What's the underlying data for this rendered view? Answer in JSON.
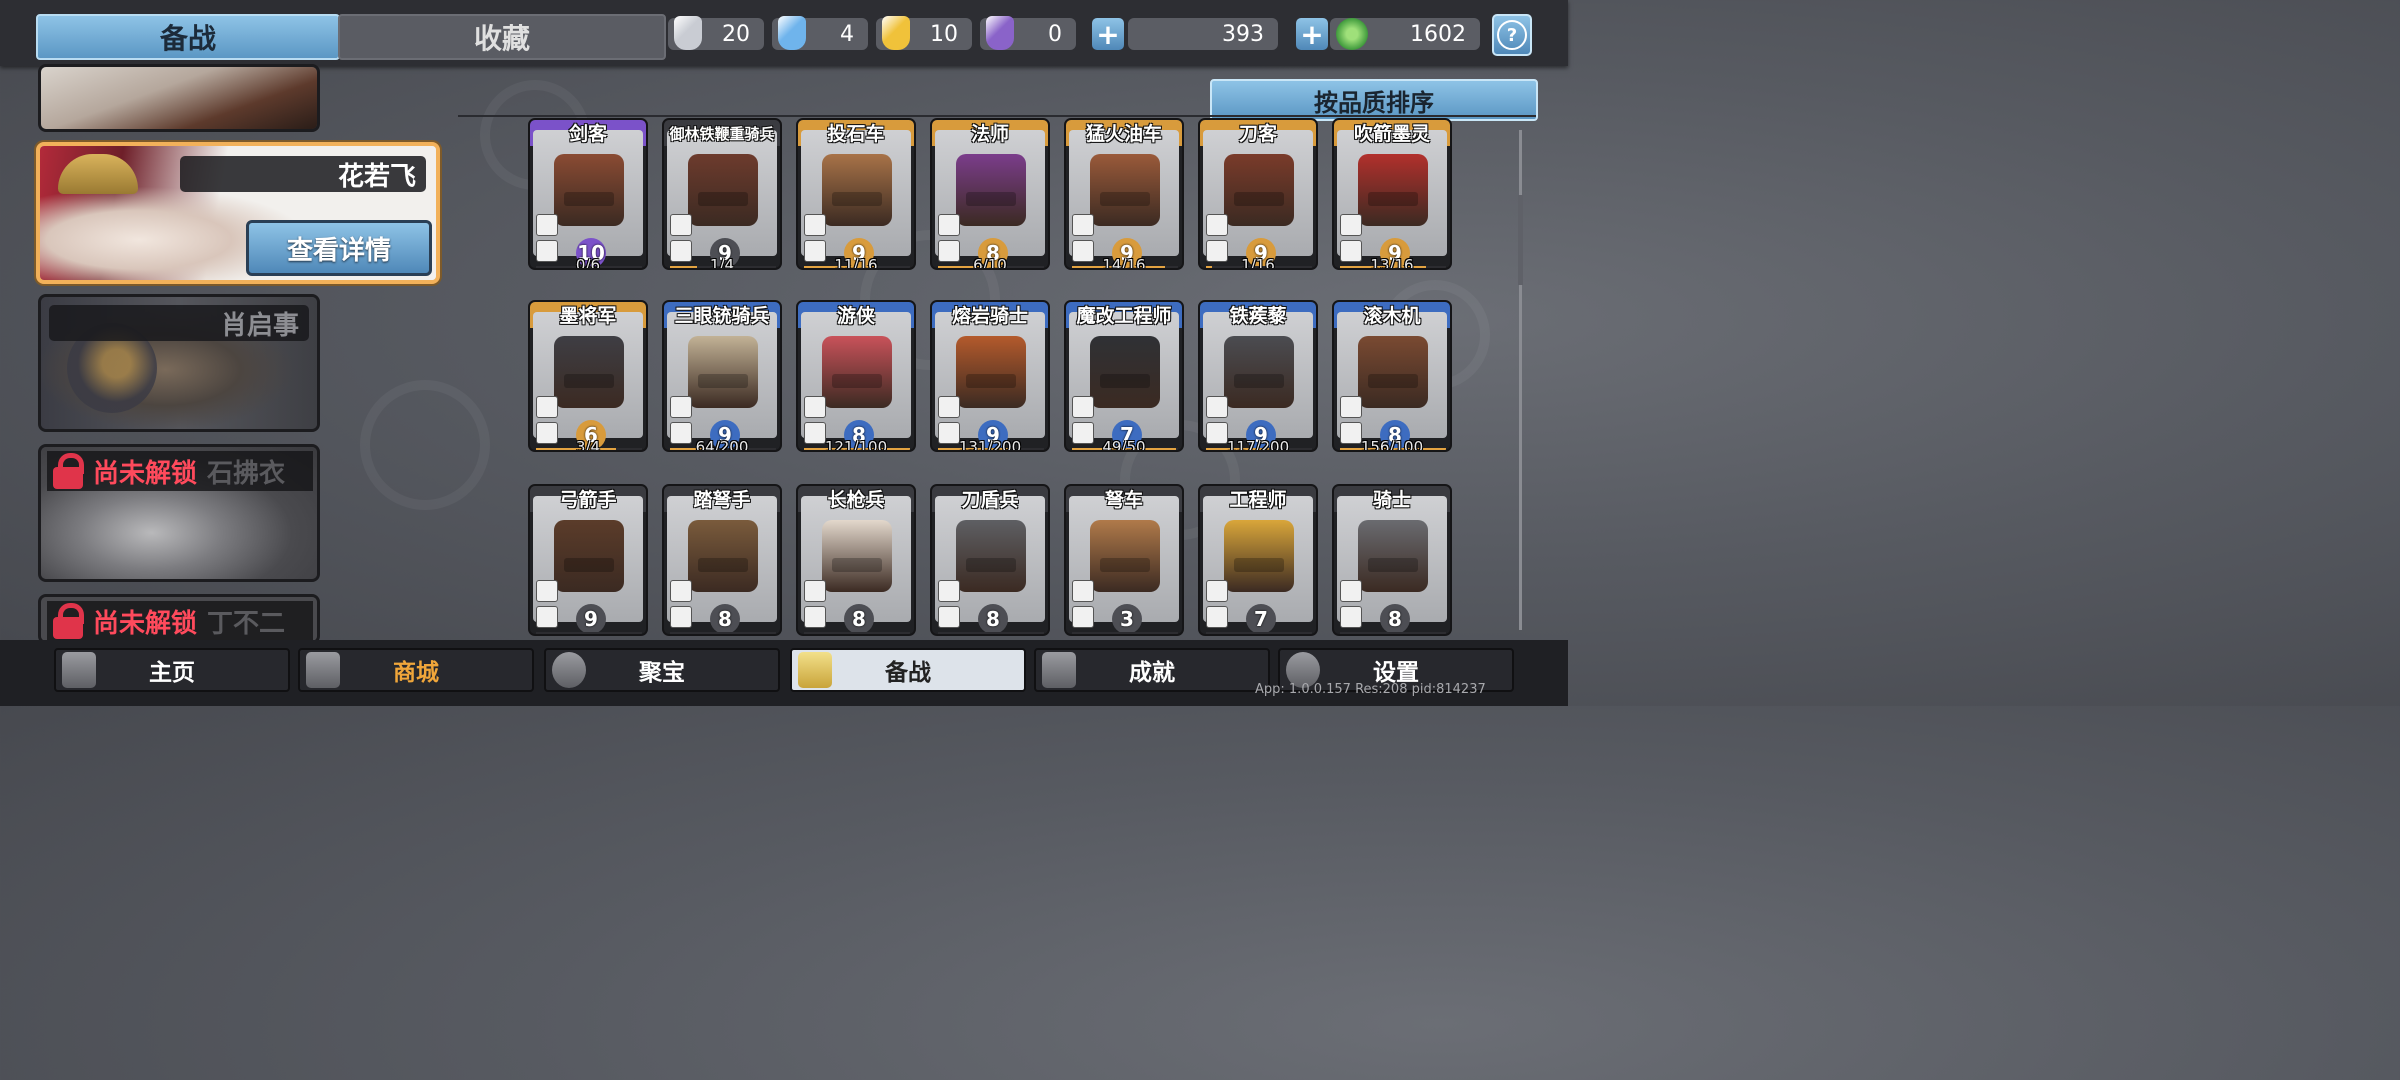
{
  "top_tabs": {
    "active": "备战",
    "inactive": "收藏"
  },
  "resources": [
    {
      "name": "silver-scroll-icon",
      "value": "20",
      "color": "#c9ccd3"
    },
    {
      "name": "blue-scroll-icon",
      "value": "4",
      "color": "#6fb4ec"
    },
    {
      "name": "gold-scroll-icon",
      "value": "10",
      "color": "#f0c23a"
    },
    {
      "name": "purple-scroll-icon",
      "value": "0",
      "color": "#8a63c9"
    }
  ],
  "silver_coins": "393",
  "jade_coins": "1602",
  "heroes": [
    {
      "name": "",
      "state": "partial"
    },
    {
      "name": "花若飞",
      "state": "selected",
      "button": "查看详情"
    },
    {
      "name": "肖启事",
      "state": "available"
    },
    {
      "name": "石拂衣",
      "state": "locked",
      "lock_text": "尚未解锁"
    },
    {
      "name": "丁不二",
      "state": "locked",
      "lock_text": "尚未解锁"
    }
  ],
  "sort_label": "按品质排序",
  "units": [
    {
      "name": "剑客",
      "level": "10",
      "progress": "0/6",
      "fill": 0.0,
      "quality": "purple"
    },
    {
      "name": "御林铁鞭重骑兵",
      "level": "9",
      "progress": "1/4",
      "fill": 0.25,
      "quality": "gray"
    },
    {
      "name": "投石车",
      "level": "9",
      "progress": "11/16",
      "fill": 0.69,
      "quality": "gold"
    },
    {
      "name": "法师",
      "level": "8",
      "progress": "6/10",
      "fill": 0.6,
      "quality": "gold"
    },
    {
      "name": "猛火油车",
      "level": "9",
      "progress": "14/16",
      "fill": 0.88,
      "quality": "gold"
    },
    {
      "name": "刀客",
      "level": "9",
      "progress": "1/16",
      "fill": 0.06,
      "quality": "gold"
    },
    {
      "name": "吹箭墨灵",
      "level": "9",
      "progress": "13/16",
      "fill": 0.81,
      "quality": "gold"
    },
    {
      "name": "墨将军",
      "level": "6",
      "progress": "3/4",
      "fill": 0.75,
      "quality": "gold"
    },
    {
      "name": "三眼铳骑兵",
      "level": "9",
      "progress": "64/200",
      "fill": 0.32,
      "quality": "blue"
    },
    {
      "name": "游侠",
      "level": "8",
      "progress": "121/100",
      "fill": 1.0,
      "quality": "blue"
    },
    {
      "name": "熔岩骑士",
      "level": "9",
      "progress": "131/200",
      "fill": 0.66,
      "quality": "blue"
    },
    {
      "name": "魔改工程师",
      "level": "7",
      "progress": "49/50",
      "fill": 0.98,
      "quality": "blue"
    },
    {
      "name": "铁蒺藜",
      "level": "9",
      "progress": "117/200",
      "fill": 0.59,
      "quality": "blue"
    },
    {
      "name": "滚木机",
      "level": "8",
      "progress": "156/100",
      "fill": 1.0,
      "quality": "blue"
    },
    {
      "name": "弓箭手",
      "level": "9",
      "progress": "",
      "fill": 0.0,
      "quality": "gray"
    },
    {
      "name": "踏弩手",
      "level": "8",
      "progress": "",
      "fill": 0.0,
      "quality": "gray"
    },
    {
      "name": "长枪兵",
      "level": "8",
      "progress": "",
      "fill": 0.0,
      "quality": "gray"
    },
    {
      "name": "刀盾兵",
      "level": "8",
      "progress": "",
      "fill": 0.0,
      "quality": "gray"
    },
    {
      "name": "弩车",
      "level": "3",
      "progress": "",
      "fill": 0.0,
      "quality": "gray"
    },
    {
      "name": "工程师",
      "level": "7",
      "progress": "",
      "fill": 0.0,
      "quality": "gray"
    },
    {
      "name": "骑士",
      "level": "8",
      "progress": "",
      "fill": 0.0,
      "quality": "gray"
    }
  ],
  "quality_colors": {
    "purple": "#7b52c9",
    "gold": "#d89b3c",
    "blue": "#3d6cc0",
    "gray": "#3a3b40"
  },
  "figure_colors": [
    "#8a4b33",
    "#6d3b2d",
    "#a87348",
    "#7b3d8b",
    "#9a5a3a",
    "#7a3b2a",
    "#b2302c",
    "#3e3e44",
    "#c2b296",
    "#c9525a",
    "#b45a2c",
    "#2f3135",
    "#4b4c51",
    "#7a4a32",
    "#5b3c2a",
    "#7a5b3c",
    "#e3d8cc",
    "#5e5f63",
    "#b07a4a",
    "#d9a63a",
    "#6a6b70"
  ],
  "nav": [
    {
      "label": "主页",
      "icon": "home-gate-icon",
      "active": false
    },
    {
      "label": "商城",
      "icon": "shop-coins-icon",
      "active": false,
      "color": "#f0a63a"
    },
    {
      "label": "聚宝",
      "icon": "treasure-eye-icon",
      "active": false
    },
    {
      "label": "备战",
      "icon": "card-deck-icon",
      "active": true
    },
    {
      "label": "成就",
      "icon": "achievement-grid-icon",
      "active": false
    },
    {
      "label": "设置",
      "icon": "settings-gear-icon",
      "active": false
    }
  ],
  "version_text": "App: 1.0.0.157 Res:208 pid:814237"
}
